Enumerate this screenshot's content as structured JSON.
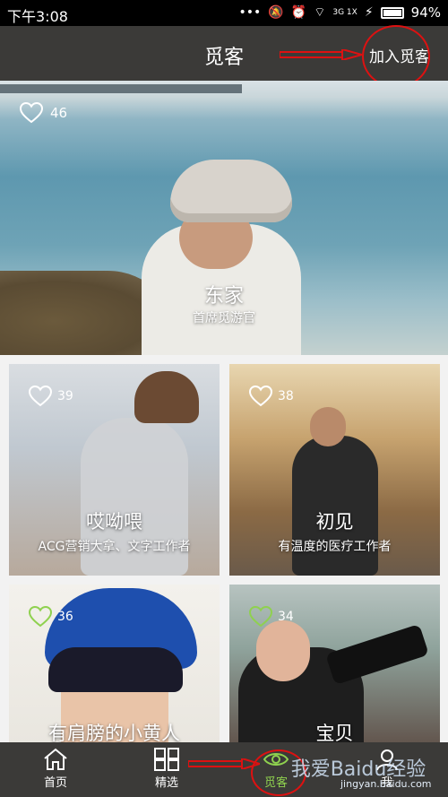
{
  "status_bar": {
    "time": "下午3:08",
    "network": "3G 1X",
    "battery": "94%"
  },
  "header": {
    "title": "觅客",
    "join_label": "加入觅客"
  },
  "hero": {
    "likes": "46",
    "name": "东家",
    "subtitle": "首席觅游官"
  },
  "cards": [
    {
      "likes": "39",
      "name": "哎呦喂",
      "subtitle": "ACG营销大拿、文字工作者"
    },
    {
      "likes": "38",
      "name": "初见",
      "subtitle": "有温度的医疗工作者"
    },
    {
      "likes": "36",
      "name": "有肩膀的小黄人",
      "subtitle": ""
    },
    {
      "likes": "34",
      "name": "宝贝",
      "subtitle": ""
    }
  ],
  "nav": {
    "home": "首页",
    "select": "精选",
    "mike": "觅客",
    "me": "我"
  },
  "watermark": {
    "text": "我爱Baidu经验",
    "url": "jingyan.baidu.com"
  },
  "colors": {
    "bar": "#3b3a38",
    "accent_green": "#8fd14f",
    "annotation_red": "#d11111"
  }
}
